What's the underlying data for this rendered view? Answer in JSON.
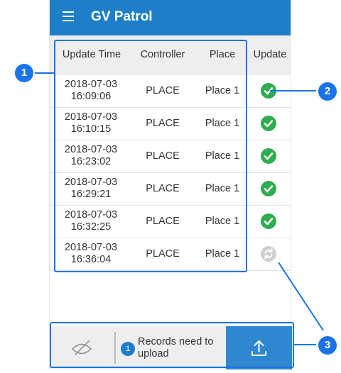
{
  "app": {
    "title": "GV Patrol"
  },
  "table": {
    "headers": {
      "time": "Update Time",
      "controller": "Controller",
      "place": "Place",
      "update": "Update"
    },
    "rows": [
      {
        "date": "2018-07-03",
        "time": "16:09:06",
        "controller": "PLACE",
        "place": "Place 1",
        "status": "uploaded"
      },
      {
        "date": "2018-07-03",
        "time": "16:10:15",
        "controller": "PLACE",
        "place": "Place 1",
        "status": "uploaded"
      },
      {
        "date": "2018-07-03",
        "time": "16:23:02",
        "controller": "PLACE",
        "place": "Place 1",
        "status": "uploaded"
      },
      {
        "date": "2018-07-03",
        "time": "16:29:21",
        "controller": "PLACE",
        "place": "Place 1",
        "status": "uploaded"
      },
      {
        "date": "2018-07-03",
        "time": "16:32:25",
        "controller": "PLACE",
        "place": "Place 1",
        "status": "uploaded"
      },
      {
        "date": "2018-07-03",
        "time": "16:36:04",
        "controller": "PLACE",
        "place": "Place 1",
        "status": "pending"
      }
    ]
  },
  "footer": {
    "badge_count": "1",
    "pending_message": "Records need to upload",
    "hide_icon": "eye-off-icon",
    "upload_icon": "upload-icon"
  },
  "callouts": {
    "one": "1",
    "two": "2",
    "three": "3"
  },
  "colors": {
    "primary": "#1e7fc8",
    "success": "#2eac4f",
    "pending": "#cfcfcf",
    "annotation": "#1a73e8"
  }
}
